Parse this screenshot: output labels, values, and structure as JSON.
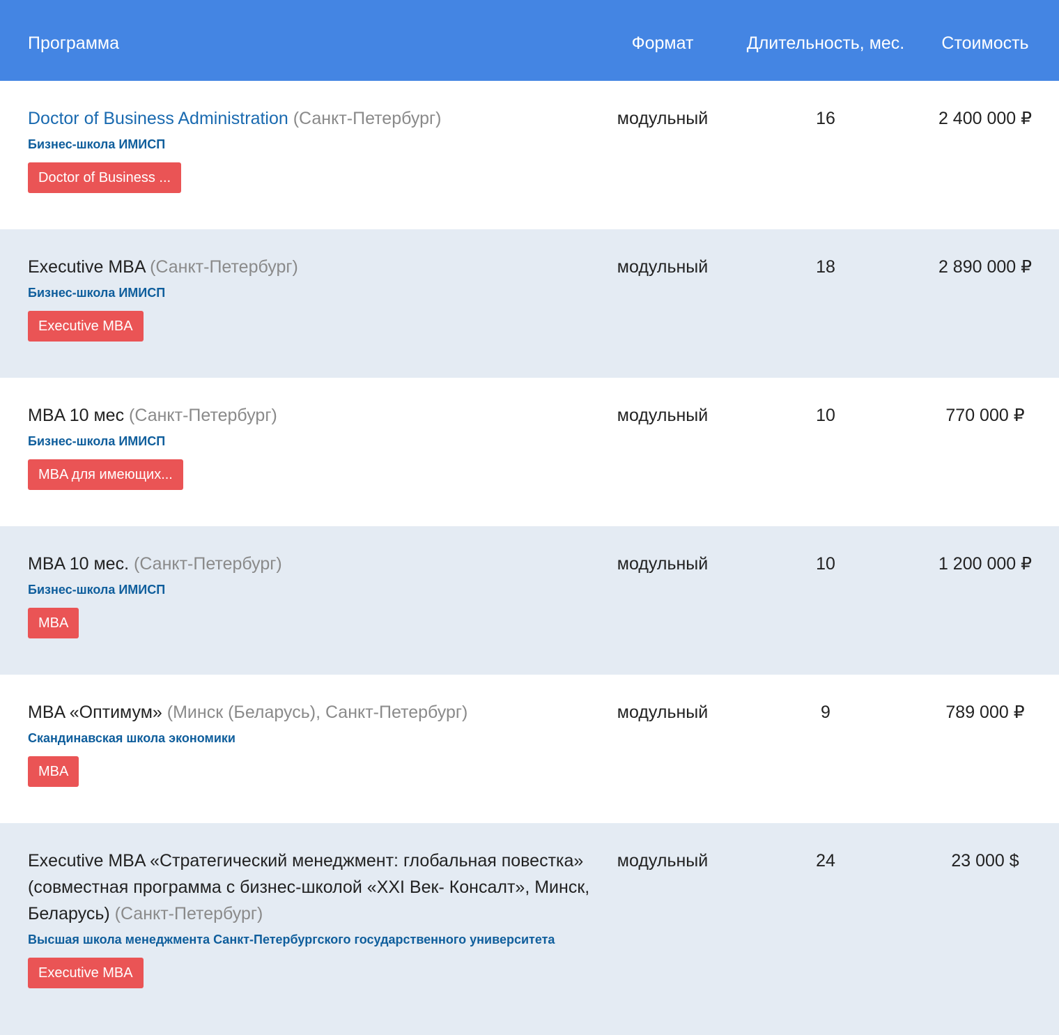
{
  "header": {
    "program": "Программа",
    "format": "Формат",
    "duration": "Длительность, мес.",
    "cost": "Стоимость"
  },
  "rows": [
    {
      "title": "Doctor of Business Administration",
      "city": "(Санкт-Петербург)",
      "school": "Бизнес-школа ИМИСП",
      "tag": "Doctor of Business ...",
      "format": "модульный",
      "duration": "16",
      "cost": "2 400 000 ₽"
    },
    {
      "title": "Executive MBA",
      "city": "(Санкт-Петербург)",
      "school": "Бизнес-школа ИМИСП",
      "tag": "Executive MBA",
      "format": "модульный",
      "duration": "18",
      "cost": "2 890 000 ₽"
    },
    {
      "title": "MBA 10 мес",
      "city": "(Санкт-Петербург)",
      "school": "Бизнес-школа ИМИСП",
      "tag": "MBA для имеющих...",
      "format": "модульный",
      "duration": "10",
      "cost": "770 000 ₽"
    },
    {
      "title": "MBA 10 мес.",
      "city": "(Санкт-Петербург)",
      "school": "Бизнес-школа ИМИСП",
      "tag": "MBA",
      "format": "модульный",
      "duration": "10",
      "cost": "1 200 000 ₽"
    },
    {
      "title": "MBA «Оптимум»",
      "city": "(Минск (Беларусь), Санкт-Петербург)",
      "school": "Скандинавская школа экономики",
      "tag": "MBA",
      "format": "модульный",
      "duration": "9",
      "cost": "789 000 ₽"
    },
    {
      "title": "Executive MBA «Стратегический менеджмент: глобальная повестка» (совместная программа с бизнес-школой «XXI Век- Консалт», Минск, Беларусь)",
      "city": "(Санкт-Петербург)",
      "school": "Высшая школа менеджмента Санкт-Петербургского государственного университета",
      "tag": "Executive MBA",
      "format": "модульный",
      "duration": "24",
      "cost": "23 000 $"
    }
  ],
  "colors": {
    "header_bg": "#4485e3",
    "alt_row_bg": "#e4ebf3",
    "tag_bg": "#ea5455",
    "school_text": "#0f5e9c",
    "link_text": "#1a6ab0",
    "city_text": "#8a8a8a"
  }
}
